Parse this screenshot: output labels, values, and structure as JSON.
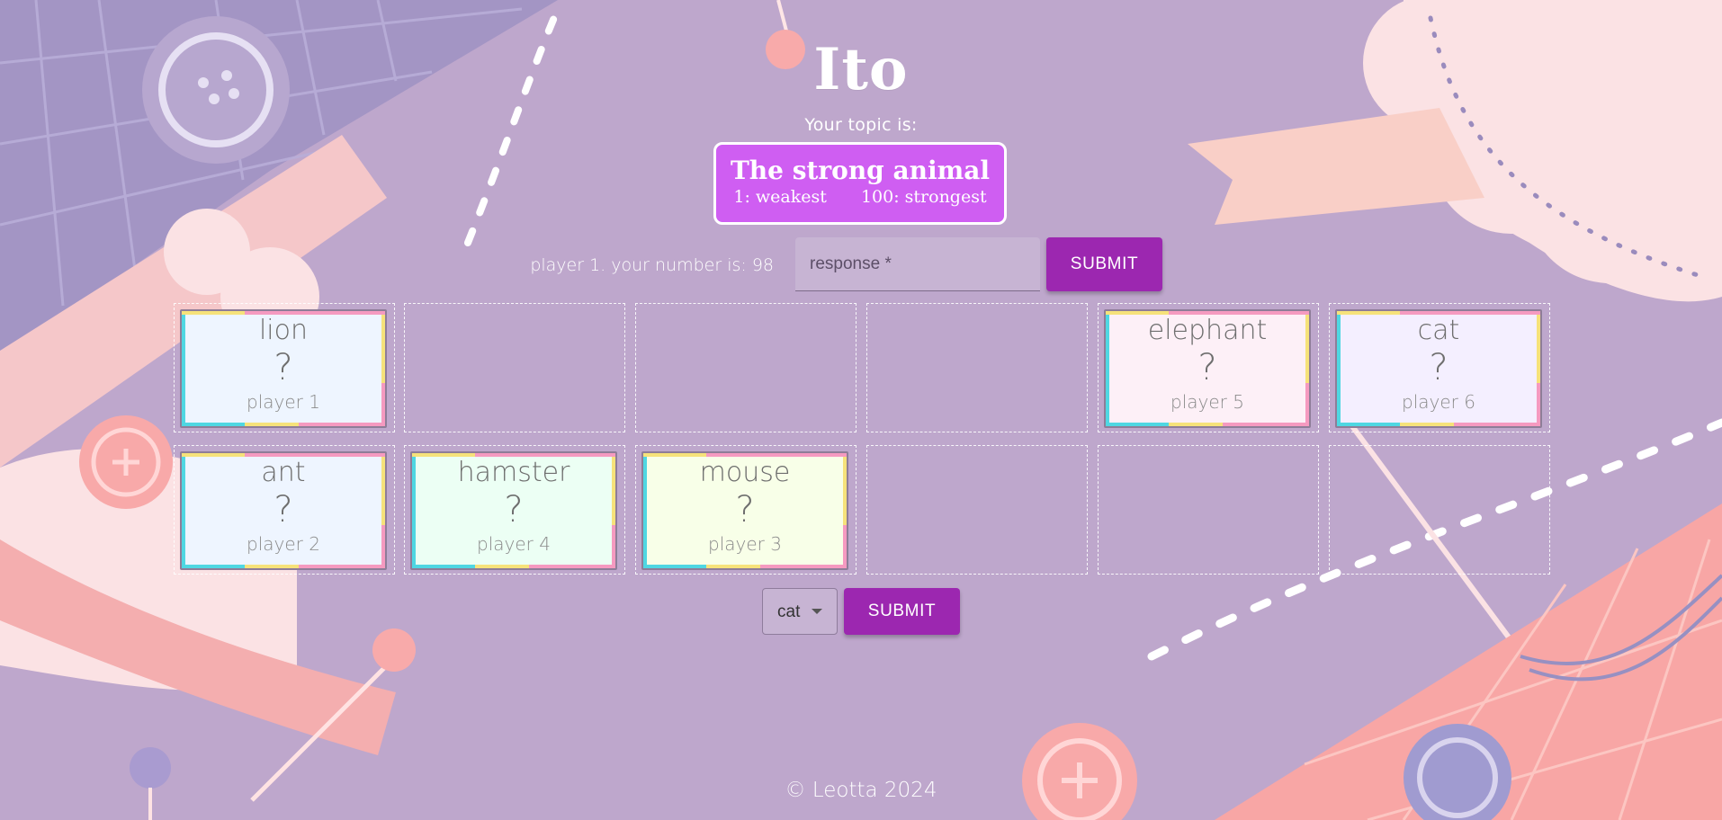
{
  "colors": {
    "background": "#bea7cc",
    "accent": "#9c27b0",
    "topic_box": "#cf5ef2"
  },
  "header": {
    "title": "Ito"
  },
  "topic": {
    "label": "Your topic is:",
    "title": "The strong animal",
    "min_label": "1: weakest",
    "max_label": "100: strongest"
  },
  "player": {
    "number_text": "player 1. your number is: 98"
  },
  "response": {
    "placeholder": "response *",
    "submit_label": "SUBMIT"
  },
  "cards": [
    {
      "word": "lion",
      "value": "?",
      "player": "player 1",
      "color": "#eef5ff"
    },
    {
      "word": "elephant",
      "value": "?",
      "player": "player 5",
      "color": "#fdf0f7"
    },
    {
      "word": "cat",
      "value": "?",
      "player": "player 6",
      "color": "#f4efff"
    },
    {
      "word": "ant",
      "value": "?",
      "player": "player 2",
      "color": "#eef5ff"
    },
    {
      "word": "hamster",
      "value": "?",
      "player": "player 4",
      "color": "#ecfff4"
    },
    {
      "word": "mouse",
      "value": "?",
      "player": "player 3",
      "color": "#f8ffe8"
    }
  ],
  "selection": {
    "selected": "cat",
    "submit_label": "SUBMIT"
  },
  "footer": {
    "text": "© Leotta 2024"
  }
}
